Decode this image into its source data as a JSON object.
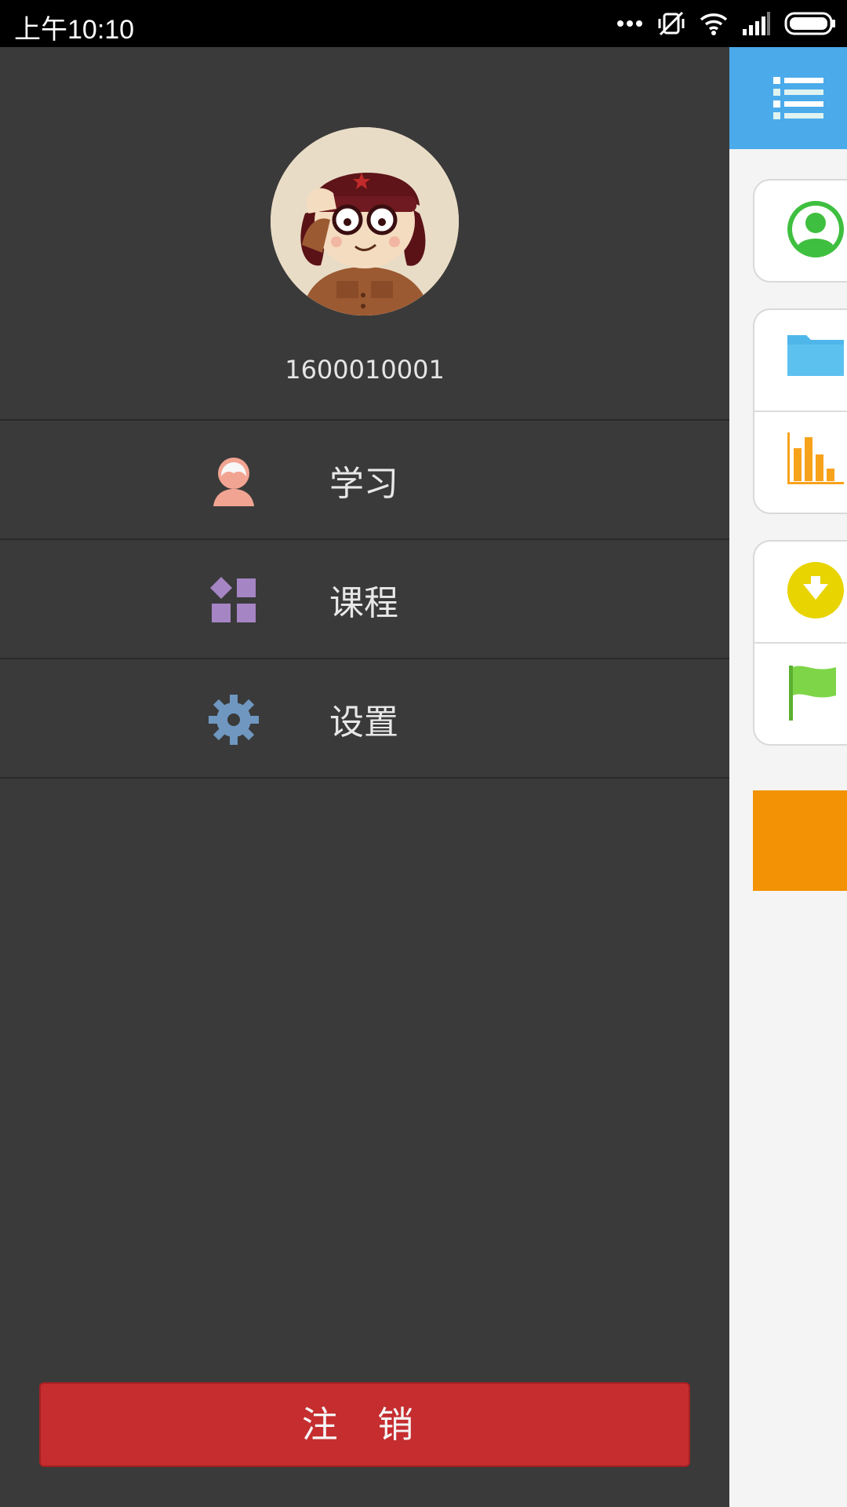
{
  "status_bar": {
    "time": "上午10:10",
    "icons": [
      "more-dots-icon",
      "vibrate-off-icon",
      "wifi-icon",
      "signal-icon",
      "battery-icon"
    ]
  },
  "drawer": {
    "username": "1600010001",
    "menu": [
      {
        "label": "学习",
        "icon": "student-icon",
        "color": "#f2a492"
      },
      {
        "label": "课程",
        "icon": "course-grid-icon",
        "color": "#a585c4"
      },
      {
        "label": "设置",
        "icon": "gear-icon",
        "color": "#6f97c0"
      }
    ],
    "logout_label": "注 销"
  },
  "main": {
    "header_icon": "list-menu-icon",
    "accent_color": "#4aaaea",
    "cards": [
      {
        "icons": [
          "profile-icon"
        ]
      },
      {
        "icons": [
          "folder-icon",
          "bar-chart-icon"
        ]
      },
      {
        "icons": [
          "download-icon",
          "flag-icon"
        ]
      }
    ]
  }
}
